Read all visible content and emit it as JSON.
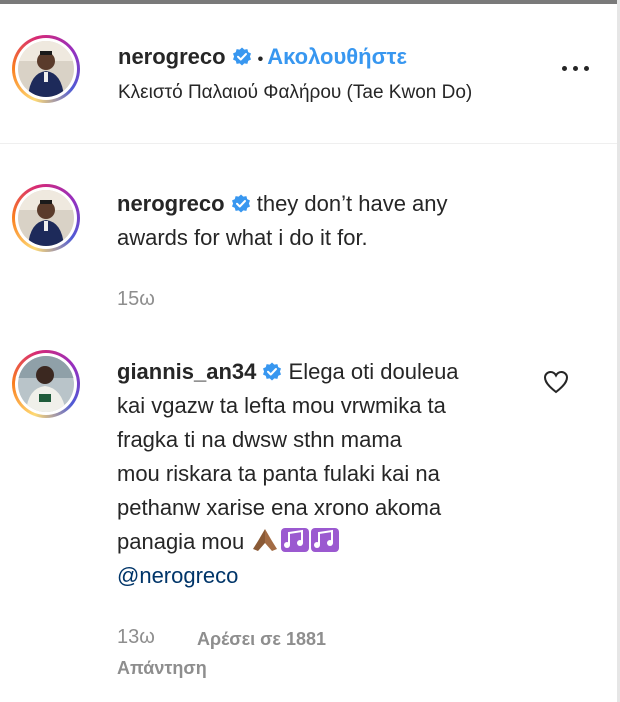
{
  "post_header": {
    "username": "nerogreco",
    "separator": "•",
    "follow_label": "Ακολουθήστε",
    "location": "Κλειστό Παλαιού Φαλήρου (Tae Kwon Do)"
  },
  "caption": {
    "username": "nerogreco",
    "text_line1": "they don’t have any",
    "text_line2": "awards for what i do it for.",
    "time": "15ω"
  },
  "comment": {
    "username": "giannis_an34",
    "line1": "Elega oti douleua",
    "line2": "kai vgazw ta lefta mou vrwmika ta",
    "line3": "fragka ti na dwsw sthn mama",
    "line4": "mou riskara ta panta fulaki kai na",
    "line5": "pethanw xarise ena xrono akoma",
    "line6": "panagia mou",
    "mention": "@nerogreco",
    "time": "13ω",
    "likes": "Αρέσει σε 1881",
    "reply_label": "Απάντηση",
    "emojis": [
      "praying-hands-icon",
      "music-notes-icon",
      "music-notes-icon"
    ]
  },
  "colors": {
    "link_blue": "#3897f0",
    "mention_blue": "#003569",
    "muted": "#8e8e8e",
    "text": "#262626"
  }
}
